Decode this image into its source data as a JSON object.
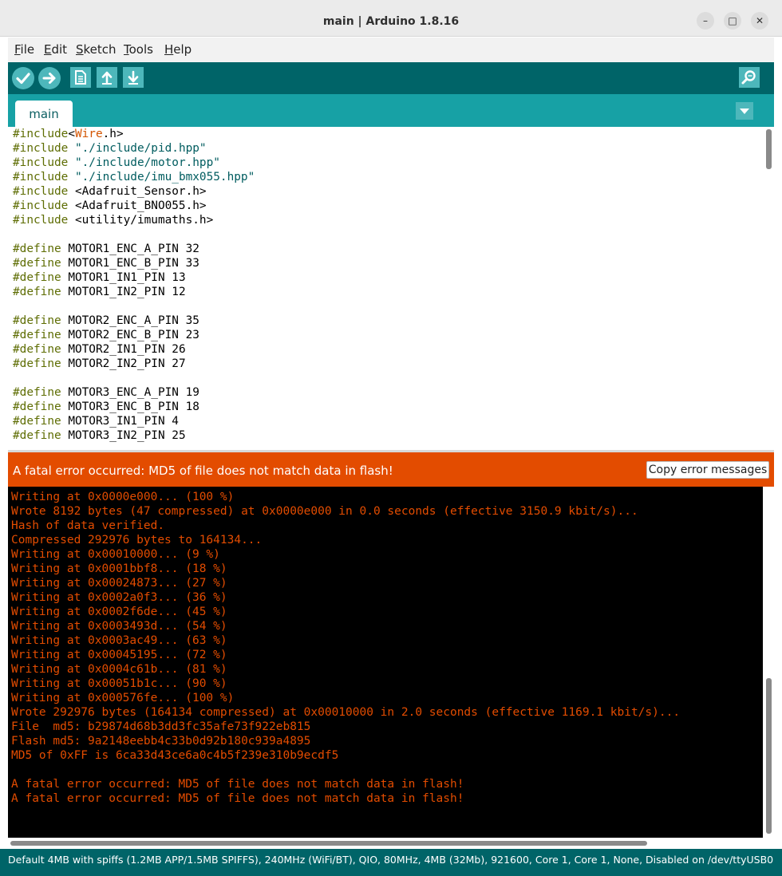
{
  "window": {
    "title": "main | Arduino 1.8.16",
    "controls": [
      "–",
      "□",
      "✕"
    ]
  },
  "menubar": {
    "items": [
      {
        "mnemonic": "F",
        "rest": "ile"
      },
      {
        "mnemonic": "E",
        "rest": "dit"
      },
      {
        "mnemonic": "S",
        "rest": "ketch"
      },
      {
        "mnemonic": "T",
        "rest": "ools"
      },
      {
        "mnemonic": "H",
        "rest": "elp"
      }
    ]
  },
  "toolbar": {
    "buttons": [
      {
        "name": "verify",
        "icon": "checkmark-icon"
      },
      {
        "name": "upload",
        "icon": "arrow-right-icon"
      },
      {
        "name": "new",
        "icon": "document-icon"
      },
      {
        "name": "open",
        "icon": "arrow-up-icon"
      },
      {
        "name": "save",
        "icon": "arrow-down-icon"
      }
    ],
    "serial_monitor_icon": "magnifier-icon"
  },
  "tabs": {
    "items": [
      {
        "label": "main"
      }
    ],
    "menu_icon": "triangle-down-icon"
  },
  "editor": {
    "lines": [
      [
        {
          "t": "#include",
          "c": "dir"
        },
        {
          "t": "<"
        },
        {
          "t": "Wire",
          "c": "lib"
        },
        {
          "t": ".h>"
        }
      ],
      [
        {
          "t": "#include",
          "c": "dir"
        },
        {
          "t": " "
        },
        {
          "t": "\"./include/pid.hpp\"",
          "c": "str"
        }
      ],
      [
        {
          "t": "#include",
          "c": "dir"
        },
        {
          "t": " "
        },
        {
          "t": "\"./include/motor.hpp\"",
          "c": "str"
        }
      ],
      [
        {
          "t": "#include",
          "c": "dir"
        },
        {
          "t": " "
        },
        {
          "t": "\"./include/imu_bmx055.hpp\"",
          "c": "str"
        }
      ],
      [
        {
          "t": "#include",
          "c": "dir"
        },
        {
          "t": " <Adafruit_Sensor.h>"
        }
      ],
      [
        {
          "t": "#include",
          "c": "dir"
        },
        {
          "t": " <Adafruit_BNO055.h>"
        }
      ],
      [
        {
          "t": "#include",
          "c": "dir"
        },
        {
          "t": " <utility/imumaths.h>"
        }
      ],
      [],
      [
        {
          "t": "#define",
          "c": "dir"
        },
        {
          "t": " MOTOR1_ENC_A_PIN 32"
        }
      ],
      [
        {
          "t": "#define",
          "c": "dir"
        },
        {
          "t": " MOTOR1_ENC_B_PIN 33"
        }
      ],
      [
        {
          "t": "#define",
          "c": "dir"
        },
        {
          "t": " MOTOR1_IN1_PIN 13"
        }
      ],
      [
        {
          "t": "#define",
          "c": "dir"
        },
        {
          "t": " MOTOR1_IN2_PIN 12"
        }
      ],
      [],
      [
        {
          "t": "#define",
          "c": "dir"
        },
        {
          "t": " MOTOR2_ENC_A_PIN 35"
        }
      ],
      [
        {
          "t": "#define",
          "c": "dir"
        },
        {
          "t": " MOTOR2_ENC_B_PIN 23"
        }
      ],
      [
        {
          "t": "#define",
          "c": "dir"
        },
        {
          "t": " MOTOR2_IN1_PIN 26"
        }
      ],
      [
        {
          "t": "#define",
          "c": "dir"
        },
        {
          "t": " MOTOR2_IN2_PIN 27"
        }
      ],
      [],
      [
        {
          "t": "#define",
          "c": "dir"
        },
        {
          "t": " MOTOR3_ENC_A_PIN 19"
        }
      ],
      [
        {
          "t": "#define",
          "c": "dir"
        },
        {
          "t": " MOTOR3_ENC_B_PIN 18"
        }
      ],
      [
        {
          "t": "#define",
          "c": "dir"
        },
        {
          "t": " MOTOR3_IN1_PIN 4"
        }
      ],
      [
        {
          "t": "#define",
          "c": "dir"
        },
        {
          "t": " MOTOR3_IN2_PIN 25"
        }
      ]
    ]
  },
  "error_bar": {
    "message": "A fatal error occurred: MD5 of file does not match data in flash!",
    "copy_button": "Copy error messages"
  },
  "console": {
    "lines": [
      "Writing at 0x0000e000... (100 %)",
      "Wrote 8192 bytes (47 compressed) at 0x0000e000 in 0.0 seconds (effective 3150.9 kbit/s)...",
      "Hash of data verified.",
      "Compressed 292976 bytes to 164134...",
      "Writing at 0x00010000... (9 %)",
      "Writing at 0x0001bbf8... (18 %)",
      "Writing at 0x00024873... (27 %)",
      "Writing at 0x0002a0f3... (36 %)",
      "Writing at 0x0002f6de... (45 %)",
      "Writing at 0x0003493d... (54 %)",
      "Writing at 0x0003ac49... (63 %)",
      "Writing at 0x00045195... (72 %)",
      "Writing at 0x0004c61b... (81 %)",
      "Writing at 0x00051b1c... (90 %)",
      "Writing at 0x000576fe... (100 %)",
      "Wrote 292976 bytes (164134 compressed) at 0x00010000 in 2.0 seconds (effective 1169.1 kbit/s)...",
      "File  md5: b29874d68b3dd3fc35afe73f922eb815",
      "Flash md5: 9a2148eebb4c33b0d92b180c939a4895",
      "MD5 of 0xFF is 6ca33d43ce6a0c4b5f239e310b9ecdf5",
      "",
      "A fatal error occurred: MD5 of file does not match data in flash!",
      "A fatal error occurred: MD5 of file does not match data in flash!"
    ]
  },
  "status_bar": {
    "text": "Default 4MB with spiffs (1.2MB APP/1.5MB SPIFFS), 240MHz (WiFi/BT), QIO, 80MHz, 4MB (32Mb), 921600, Core 1, Core 1, None, Disabled on /dev/ttyUSB0"
  },
  "colors": {
    "toolbar": "#006468",
    "tabbar": "#17a1a5",
    "button": "#4db7bb",
    "error": "#e34c00",
    "console_bg": "#000000"
  }
}
